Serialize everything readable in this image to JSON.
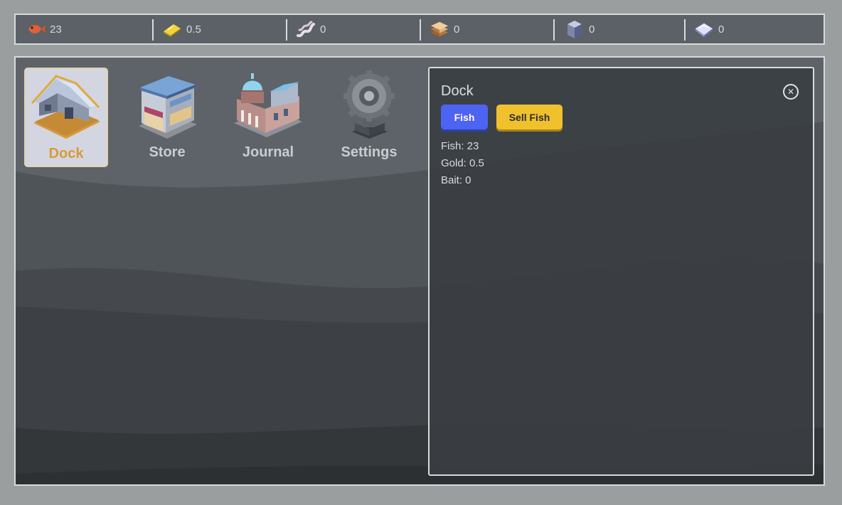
{
  "resources": [
    {
      "icon": "fish-icon",
      "value": "23"
    },
    {
      "icon": "gold-bar-icon",
      "value": "0.5"
    },
    {
      "icon": "worm-bait-icon",
      "value": "0"
    },
    {
      "icon": "wood-planks-icon",
      "value": "0"
    },
    {
      "icon": "stone-block-icon",
      "value": "0"
    },
    {
      "icon": "crystal-icon",
      "value": "0"
    }
  ],
  "buildings": [
    {
      "label": "Dock",
      "active": true
    },
    {
      "label": "Store",
      "active": false
    },
    {
      "label": "Journal",
      "active": false
    },
    {
      "label": "Settings",
      "active": false
    }
  ],
  "panel": {
    "title": "Dock",
    "close_icon": "close-icon",
    "fish_button": "Fish",
    "sell_button": "Sell Fish",
    "stats": [
      "Fish: 23",
      "Gold: 0.5",
      "Bait: 0"
    ]
  },
  "colors": {
    "fish_button": "#4d63f2",
    "sell_button": "#f0c12c",
    "active_label": "#d89a3a"
  }
}
